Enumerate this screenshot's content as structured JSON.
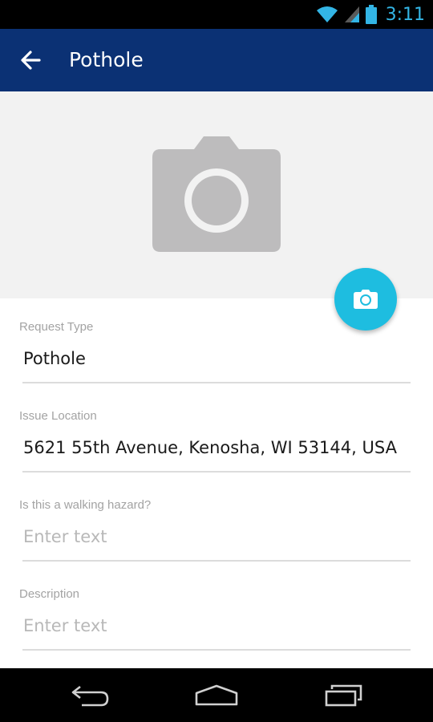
{
  "status_bar": {
    "time": "3:11",
    "icons": [
      "wifi-icon",
      "signal-icon",
      "battery-icon"
    ],
    "accent_color": "#33b5e5"
  },
  "app_bar": {
    "title": "Pothole",
    "back_icon": "arrow-back-icon",
    "background_color": "#0b3174"
  },
  "photo": {
    "placeholder_icon": "camera-placeholder-icon",
    "fab_icon": "camera-icon",
    "fab_color": "#1ebde0"
  },
  "form": {
    "request_type": {
      "label": "Request Type",
      "value": "Pothole",
      "placeholder": ""
    },
    "issue_location": {
      "label": "Issue Location",
      "value": "5621 55th Avenue, Kenosha, WI 53144, USA",
      "placeholder": ""
    },
    "walking_hazard": {
      "label": "Is this a walking hazard?",
      "value": "",
      "placeholder": "Enter text"
    },
    "description": {
      "label": "Description",
      "value": "",
      "placeholder": "Enter text"
    }
  },
  "nav_bar": {
    "buttons": [
      "back-nav-icon",
      "home-nav-icon",
      "recent-apps-icon"
    ]
  }
}
